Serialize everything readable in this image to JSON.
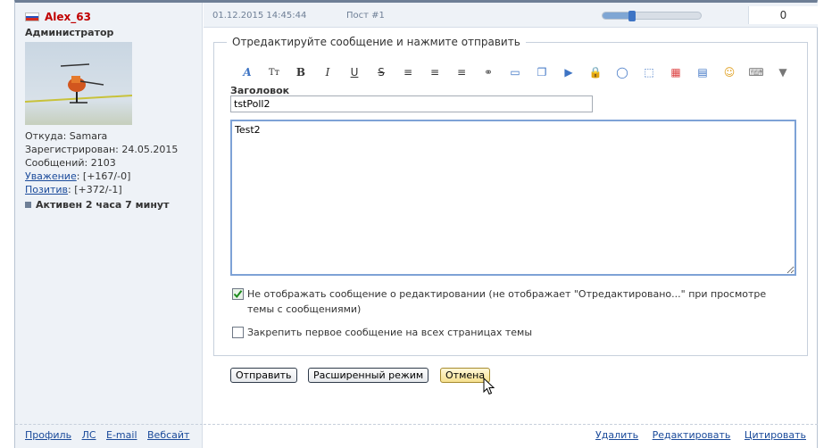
{
  "user": {
    "name": "Alex_63",
    "role": "Администратор",
    "from": "Откуда: Samara",
    "registered": "Зарегистрирован: 24.05.2015",
    "posts": "Сообщений: 2103",
    "respect_link": "Уважение",
    "respect_value": ": [+167/-0]",
    "positive_link": "Позитив",
    "positive_value": ": [+372/-1]",
    "active": "Активен 2 часа 7 минут",
    "links": [
      "Профиль",
      "ЛС",
      "E-mail",
      "Вебсайт"
    ]
  },
  "post": {
    "date": "01.12.2015 14:45:44",
    "number": "Пост #1",
    "rating": "0",
    "slider_level": 0.3
  },
  "editor": {
    "legend": "Отредактируйте сообщение и нажмите отправить",
    "title_label": "Заголовок",
    "title_value": "tstPoll2",
    "message_value": "Test2",
    "option_no_edit_notice": "Не отображать сообщение о редактировании (не отображает \"Отредактировано...\" при просмотре темы с сообщениями)",
    "option_pin_first": "Закрепить первое сообщение на всех страницах темы",
    "toolbar_icons": [
      "font-icon",
      "font-size-icon",
      "bold-icon",
      "italic-icon",
      "underline-icon",
      "strikethrough-icon",
      "align-left-icon",
      "align-center-icon",
      "align-right-icon",
      "link-icon",
      "book-icon",
      "copy-icon",
      "play-icon",
      "lock-icon",
      "speech-bubble-icon",
      "image-icon",
      "color-grid-icon",
      "table-icon",
      "smiley-icon",
      "keyboard-icon",
      "more-dropdown-icon"
    ],
    "toolbar_glyphs": [
      "A",
      "Тт",
      "B",
      "I",
      "U",
      "S",
      "≡",
      "≡",
      "≡",
      "⚭",
      "▭",
      "❐",
      "▶",
      "🔒",
      "◯",
      "⬚",
      "▦",
      "▤",
      "☺",
      "⌨",
      "▼"
    ]
  },
  "buttons": {
    "submit": "Отправить",
    "advanced": "Расширенный режим",
    "cancel": "Отмена"
  },
  "post_links": [
    "Удалить",
    "Редактировать",
    "Цитировать"
  ]
}
